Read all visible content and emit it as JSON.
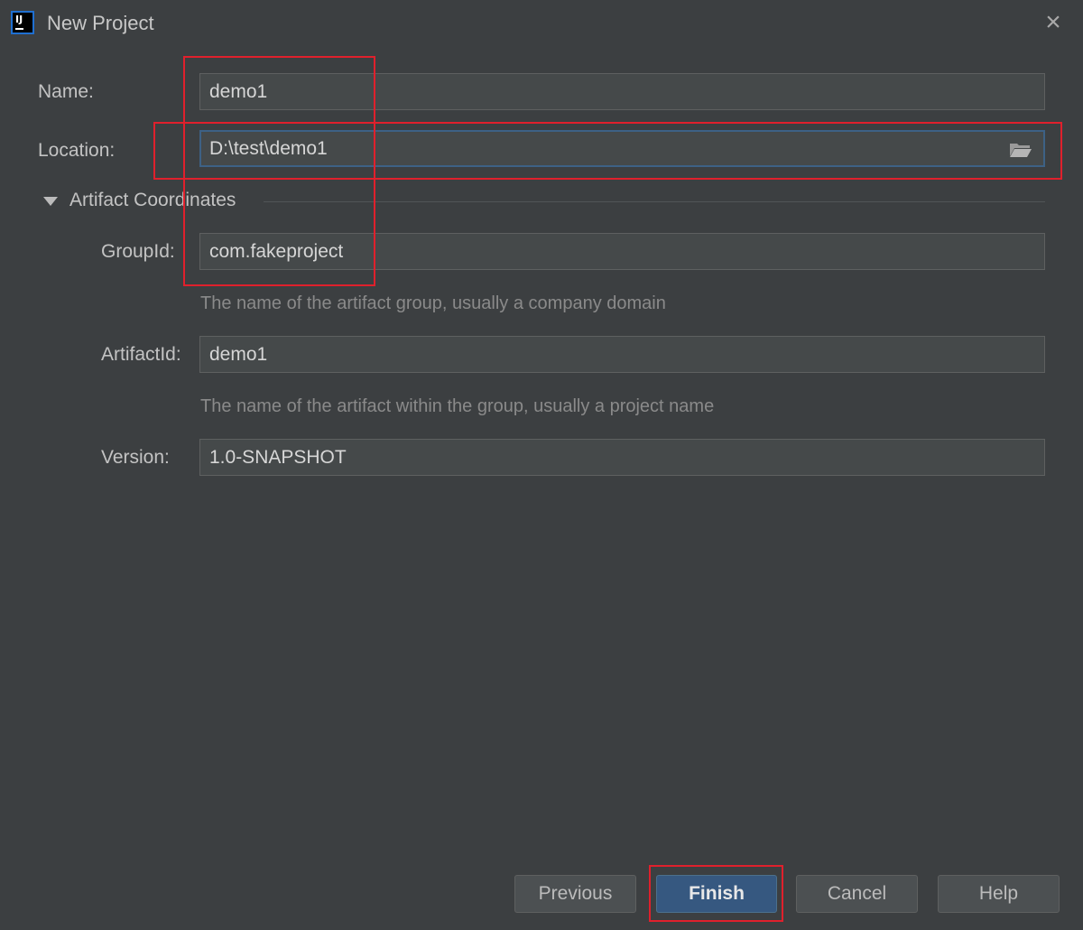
{
  "window": {
    "title": "New Project",
    "logo_text": "IJ"
  },
  "form": {
    "name": {
      "label": "Name:",
      "value": "demo1"
    },
    "location": {
      "label": "Location:",
      "value": "D:\\test\\demo1"
    },
    "artifact_section": {
      "title": "Artifact Coordinates"
    },
    "group_id": {
      "label": "GroupId:",
      "value": "com.fakeproject",
      "hint": "The name of the artifact group, usually a company domain"
    },
    "artifact_id": {
      "label": "ArtifactId:",
      "value": "demo1",
      "hint": "The name of the artifact within the group, usually a project name"
    },
    "version": {
      "label": "Version:",
      "value": "1.0-SNAPSHOT"
    }
  },
  "buttons": {
    "previous": "Previous",
    "finish": "Finish",
    "cancel": "Cancel",
    "help": "Help"
  },
  "colors": {
    "background": "#3c3f41",
    "field": "#45494a",
    "primary_button": "#365880",
    "annotation": "#e0202c"
  }
}
